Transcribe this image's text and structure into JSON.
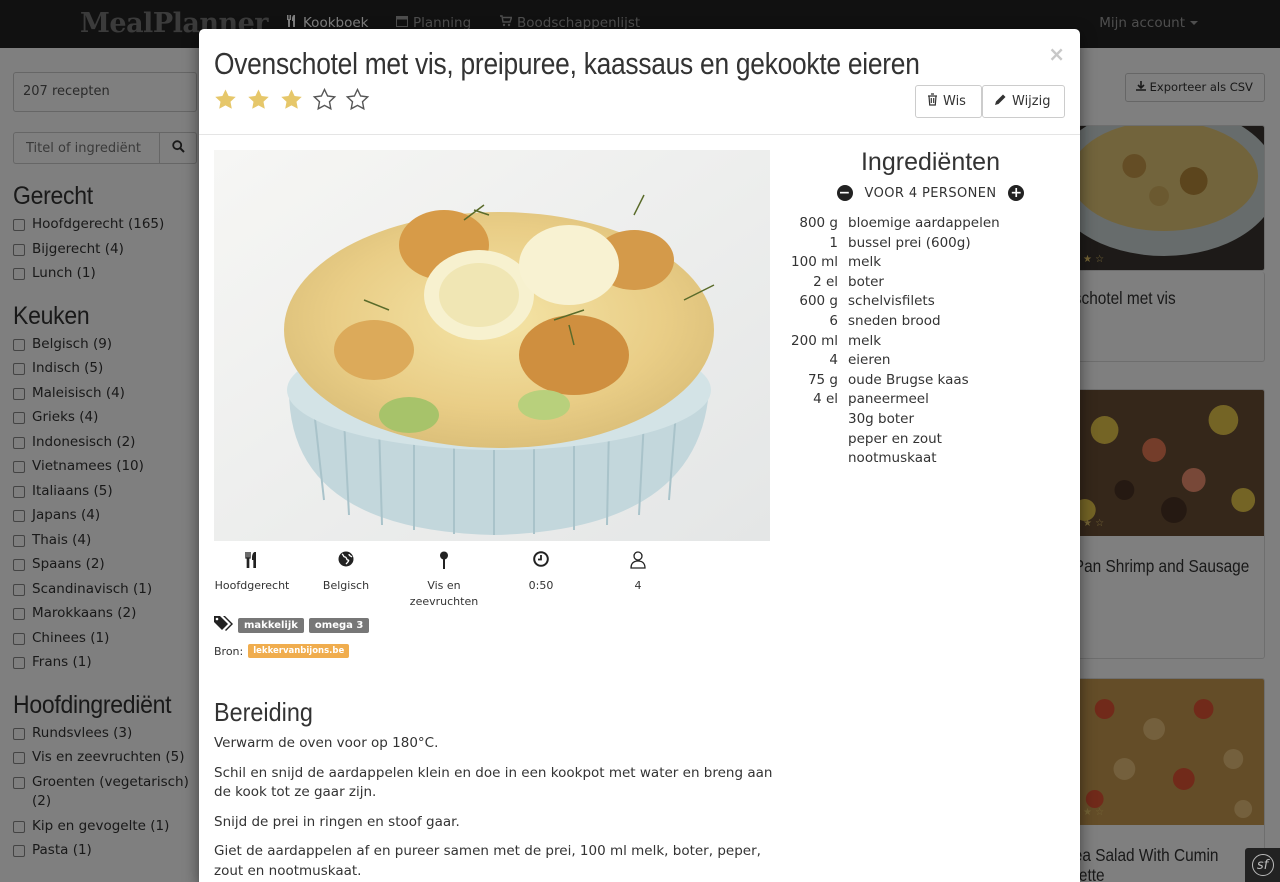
{
  "navbar": {
    "brand": "MealPlanner",
    "items": [
      {
        "label": "Kookboek",
        "icon": "cutlery-icon",
        "active": true
      },
      {
        "label": "Planning",
        "icon": "calendar-icon",
        "active": false
      },
      {
        "label": "Boodschappenlijst",
        "icon": "shopping-cart-icon",
        "active": false
      }
    ],
    "account": "Mijn account"
  },
  "sidebar": {
    "recipe_count": "207 recepten",
    "search_placeholder": "Titel of ingrediënt",
    "facets": [
      {
        "title": "Gerecht",
        "items": [
          "Hoofdgerecht (165)",
          "Bijgerecht (4)",
          "Lunch (1)"
        ]
      },
      {
        "title": "Keuken",
        "items": [
          "Belgisch (9)",
          "Indisch (5)",
          "Maleisisch (4)",
          "Grieks (4)",
          "Indonesisch (2)",
          "Vietnamees (10)",
          "Italiaans (5)",
          "Japans (4)",
          "Thais (4)",
          "Spaans (2)",
          "Scandinavisch (1)",
          "Marokkaans (2)",
          "Chinees (1)",
          "Frans (1)"
        ]
      },
      {
        "title": "Hoofdingrediënt",
        "items": [
          "Rundsvlees (3)",
          "Vis en zeevruchten (5)",
          "Groenten (vegetarisch) (2)",
          "Kip en gevogelte (1)",
          "Pasta (1)"
        ]
      }
    ]
  },
  "background": {
    "export_button": "Exporteer als CSV",
    "cards": [
      "schotel met vis",
      "Pan Shrimp and Sausage",
      "ea Salad With Cumin rette"
    ]
  },
  "modal": {
    "title": "Ovenschotel met vis, preipuree, kaassaus en gekookte eieren",
    "rating": 3,
    "rating_max": 5,
    "delete_button": "Wis",
    "edit_button": "Wijzig",
    "close_symbol": "×",
    "meta": [
      {
        "icon": "cutlery-icon",
        "label": "Hoofdgerecht"
      },
      {
        "icon": "globe-icon",
        "label": "Belgisch"
      },
      {
        "icon": "pin-icon",
        "label": "Vis en zeevruchten"
      },
      {
        "icon": "clock-icon",
        "label": "0:50"
      },
      {
        "icon": "person-icon",
        "label": "4"
      }
    ],
    "tags": [
      "makkelijk",
      "omega 3"
    ],
    "source_label": "Bron:",
    "source": "lekkervanbijons.be",
    "ingredients_title": "Ingrediënten",
    "persons": "VOOR 4 PERSONEN",
    "ingredients": [
      {
        "qty": "800 g",
        "name": "bloemige aardappelen"
      },
      {
        "qty": "1",
        "name": "bussel prei (600g)"
      },
      {
        "qty": "100 ml",
        "name": "melk"
      },
      {
        "qty": "2 el",
        "name": "boter"
      },
      {
        "qty": "600 g",
        "name": "schelvisfilets"
      },
      {
        "qty": "6",
        "name": "sneden brood"
      },
      {
        "qty": "200 ml",
        "name": "melk"
      },
      {
        "qty": "4",
        "name": "eieren"
      },
      {
        "qty": "75 g",
        "name": "oude Brugse kaas"
      },
      {
        "qty": "4 el",
        "name": "paneermeel"
      },
      {
        "qty": "",
        "name": "30g boter"
      },
      {
        "qty": "",
        "name": "peper en zout"
      },
      {
        "qty": "",
        "name": "nootmuskaat"
      }
    ],
    "preparation_title": "Bereiding",
    "steps": [
      "Verwarm de oven voor op 180°C.",
      "Schil en snijd de aardappelen klein en doe in een kookpot met water en breng aan de kook tot ze gaar zijn.",
      "Snijd de prei in ringen en stoof gaar.",
      "Giet de aardappelen af en pureer samen met de prei, 100 ml melk, boter, peper, zout en nootmuskaat."
    ]
  },
  "colors": {
    "navbar": "#222222",
    "star": "#e6c76a",
    "tag": "#777777",
    "source_label": "#f0ad4e"
  }
}
